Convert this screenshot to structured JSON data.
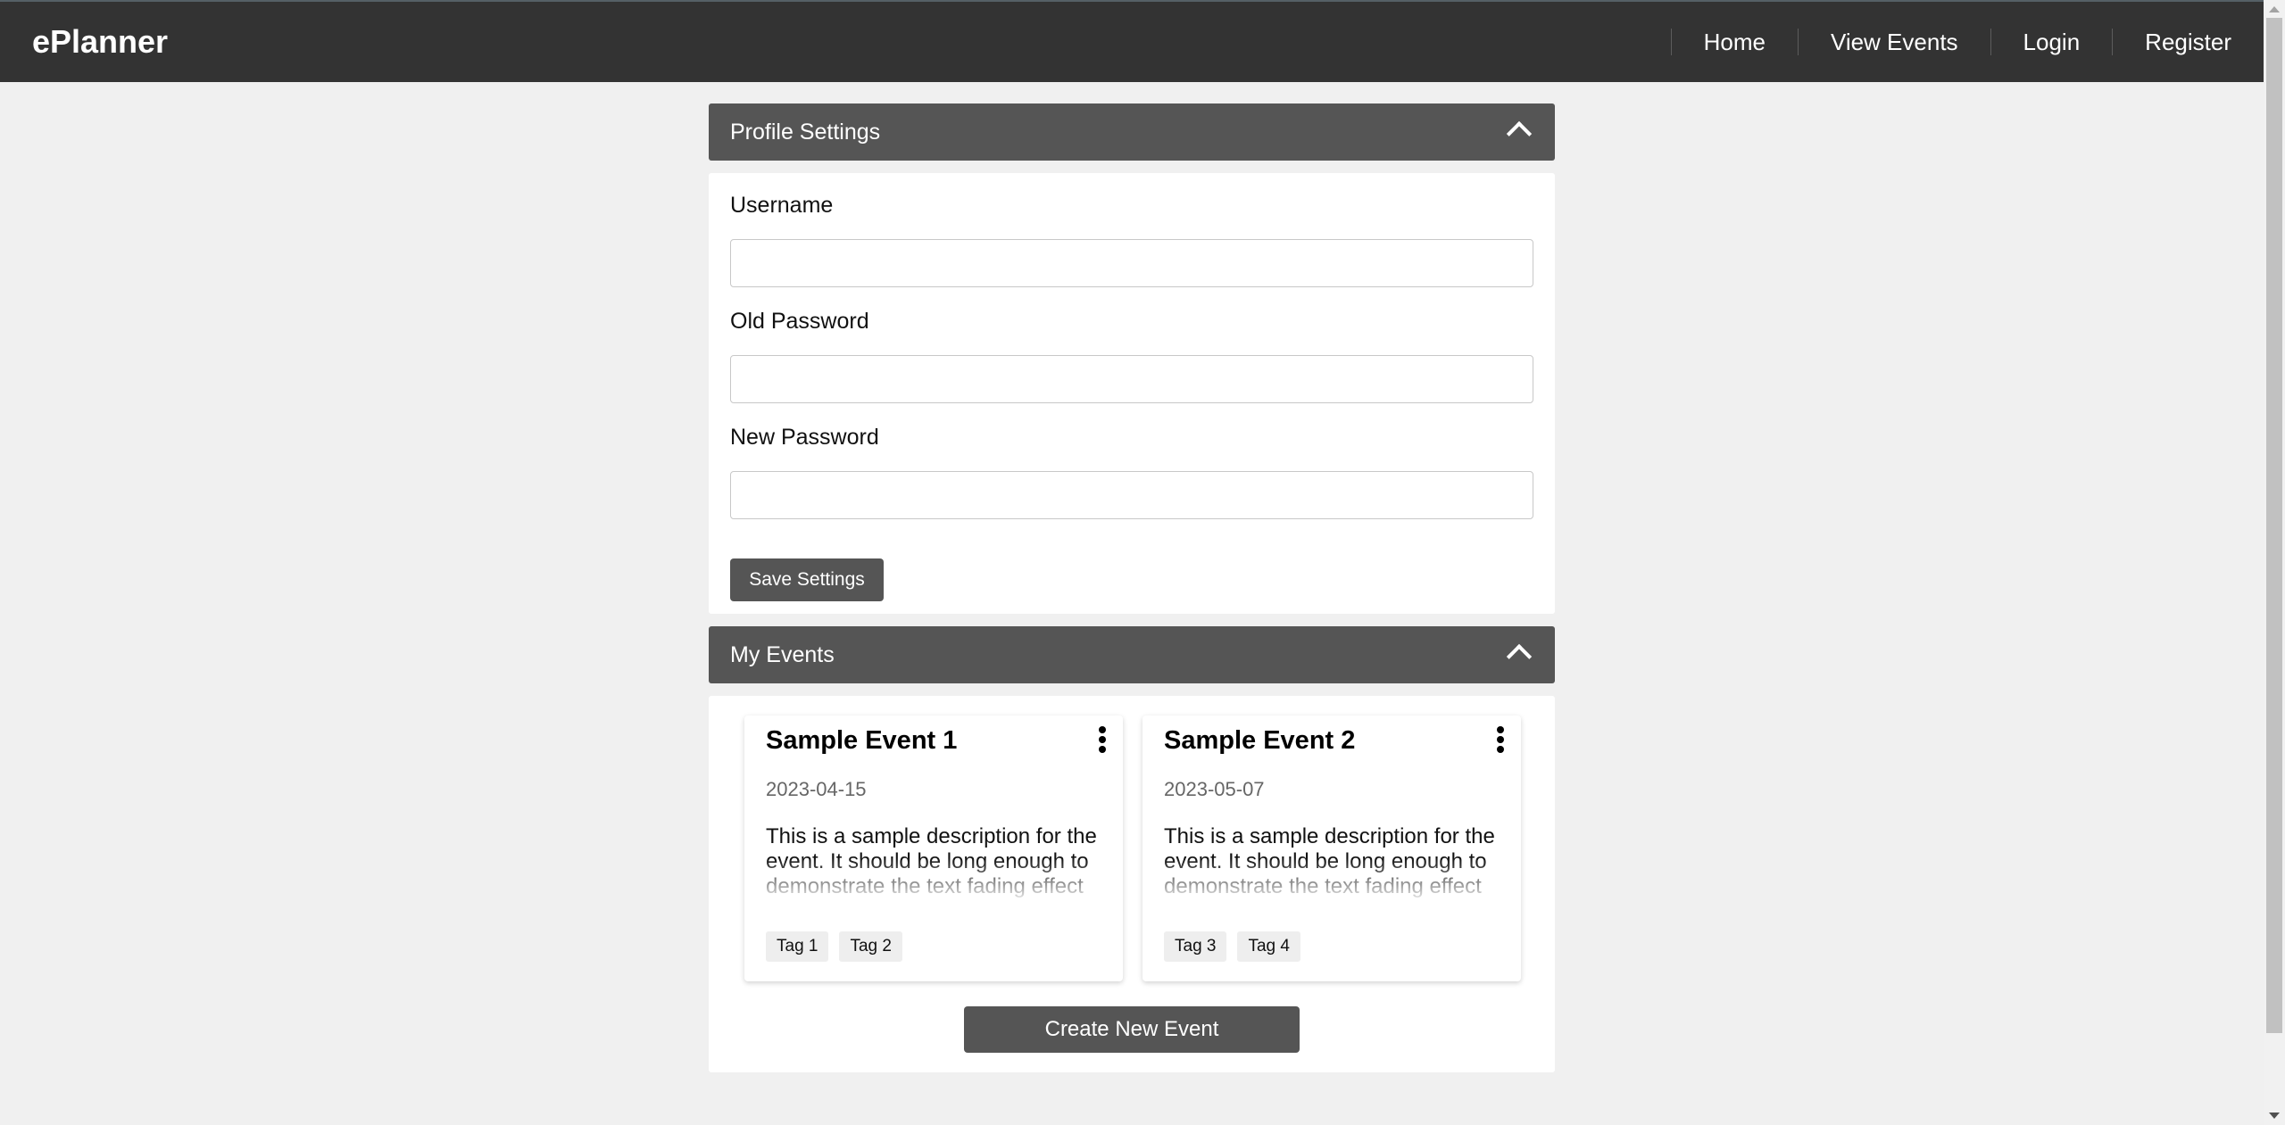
{
  "app": {
    "brand": "ePlanner"
  },
  "nav": {
    "items": [
      {
        "label": "Home"
      },
      {
        "label": "View Events"
      },
      {
        "label": "Login"
      },
      {
        "label": "Register"
      }
    ]
  },
  "profile_section": {
    "title": "Profile Settings",
    "fields": [
      {
        "label": "Username",
        "value": "",
        "placeholder": ""
      },
      {
        "label": "Old Password",
        "value": "",
        "placeholder": ""
      },
      {
        "label": "New Password",
        "value": "",
        "placeholder": ""
      }
    ],
    "save_label": "Save Settings"
  },
  "events_section": {
    "title": "My Events",
    "events": [
      {
        "title": "Sample Event 1",
        "date": "2023-04-15",
        "description": "This is a sample description for the event. It should be long enough to demonstrate the text fading effect at the bottom.",
        "tags": [
          "Tag 1",
          "Tag 2"
        ]
      },
      {
        "title": "Sample Event 2",
        "date": "2023-05-07",
        "description": "This is a sample description for the event. It should be long enough to demonstrate the text fading effect at the bottom.",
        "tags": [
          "Tag 3",
          "Tag 4"
        ]
      }
    ],
    "create_label": "Create New Event"
  }
}
